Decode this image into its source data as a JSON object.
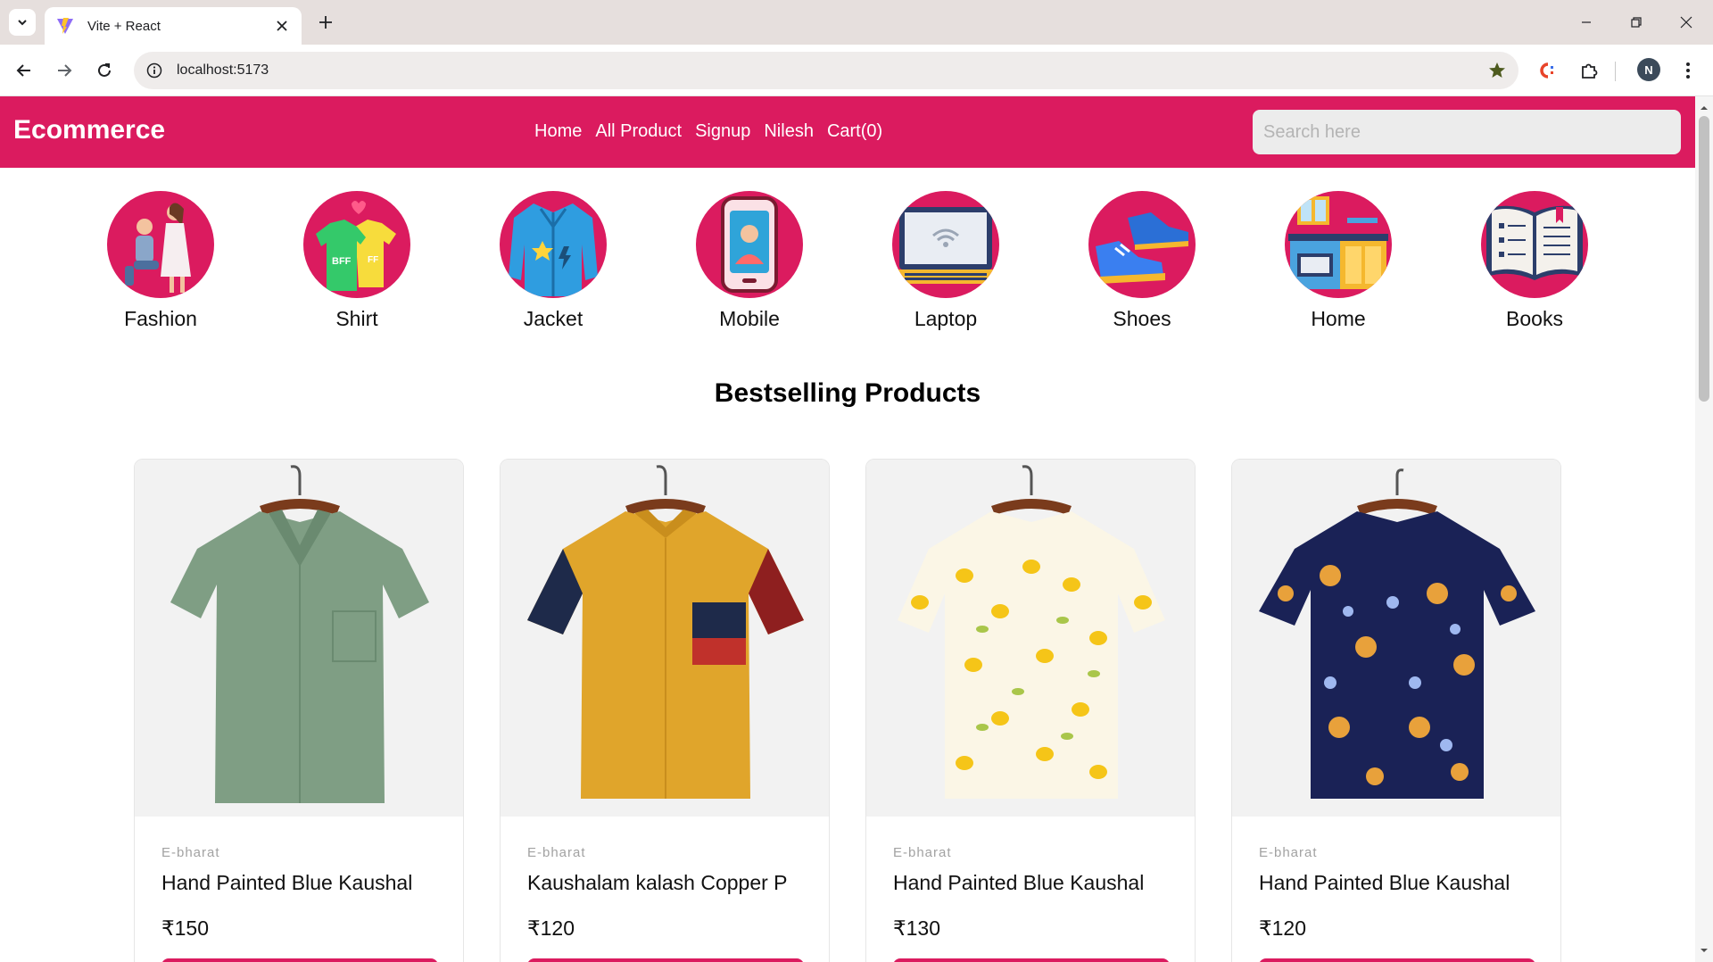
{
  "browser": {
    "tab_title": "Vite + React",
    "url": "localhost:5173",
    "profile_initial": "N"
  },
  "site": {
    "logo": "Ecommerce",
    "nav": [
      "Home",
      "All Product",
      "Signup",
      "Nilesh",
      "Cart(0)"
    ],
    "search_placeholder": "Search here",
    "brand_color": "#db1b5f"
  },
  "categories": [
    {
      "label": "Fashion",
      "icon": "couple-proposal-icon"
    },
    {
      "label": "Shirt",
      "icon": "bff-tshirts-icon"
    },
    {
      "label": "Jacket",
      "icon": "denim-jacket-icon"
    },
    {
      "label": "Mobile",
      "icon": "smartphone-icon"
    },
    {
      "label": "Laptop",
      "icon": "laptop-icon"
    },
    {
      "label": "Shoes",
      "icon": "sneakers-icon"
    },
    {
      "label": "Home",
      "icon": "kitchen-furniture-icon"
    },
    {
      "label": "Books",
      "icon": "open-book-icon"
    }
  ],
  "section_title": "Bestselling Products",
  "products": [
    {
      "brand": "E-bharat",
      "title": "Hand Painted Blue Kaushal",
      "price": "₹150",
      "image": "green-corduroy-shirt",
      "color": "#7f9e84"
    },
    {
      "brand": "E-bharat",
      "title": "Kaushalam kalash Copper P",
      "price": "₹120",
      "image": "mustard-printed-shirt",
      "color": "#e0a52b"
    },
    {
      "brand": "E-bharat",
      "title": "Hand Painted Blue Kaushal",
      "price": "₹130",
      "image": "lemon-print-shirt",
      "color": "#fbf6e6"
    },
    {
      "brand": "E-bharat",
      "title": "Hand Painted Blue Kaushal",
      "price": "₹120",
      "image": "sun-moon-print-shirt",
      "color": "#1a2256"
    }
  ]
}
